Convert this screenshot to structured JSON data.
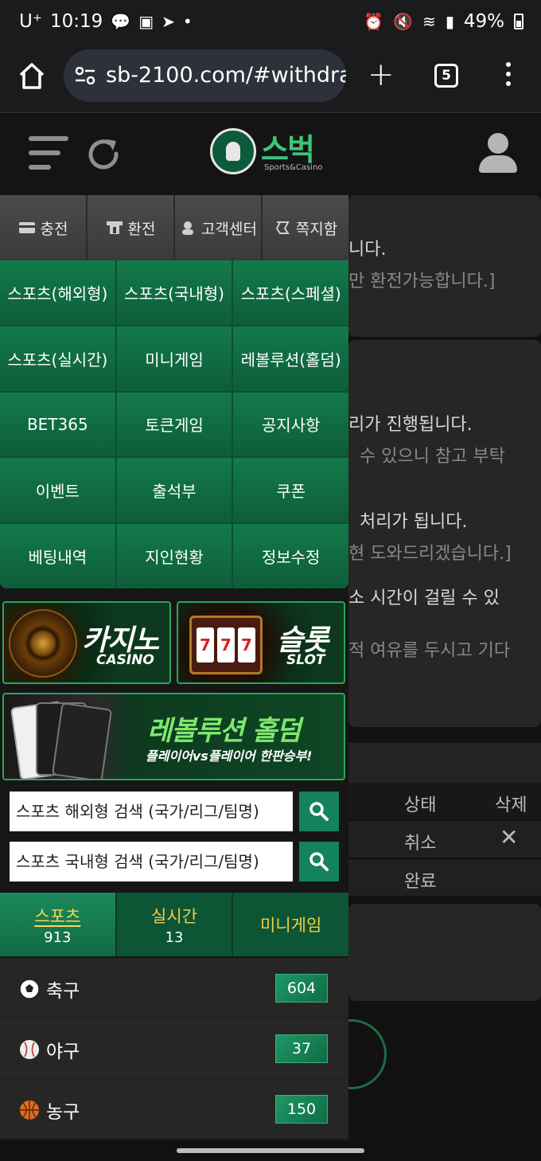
{
  "status_bar": {
    "carrier": "U⁺",
    "time": "10:19",
    "battery": "49%"
  },
  "browser": {
    "url": "sb-2100.com/#withdraw",
    "tab_count": "5"
  },
  "site": {
    "logo_name": "스벅",
    "logo_sub": "Sports&Casino"
  },
  "top_buttons": [
    {
      "label": "충전",
      "icon": "card-icon"
    },
    {
      "label": "환전",
      "icon": "atm-icon"
    },
    {
      "label": "고객센터",
      "icon": "support-agent-icon"
    },
    {
      "label": "쪽지함",
      "icon": "message-icon"
    }
  ],
  "game_menu": [
    "스포츠(해외형)",
    "스포츠(국내형)",
    "스포츠(스페셜)",
    "스포츠(실시간)",
    "미니게임",
    "레볼루션(홀덤)",
    "BET365",
    "토큰게임",
    "공지사항",
    "이벤트",
    "출석부",
    "쿠폰",
    "베팅내역",
    "지인현황",
    "정보수정"
  ],
  "banners": {
    "casino_ko": "카지노",
    "casino_en": "CASINO",
    "slot_ko": "슬롯",
    "slot_en": "SLOT",
    "holdem_title": "레볼루션 홀덤",
    "holdem_sub": "플레이어vs플레이어 한판승부!"
  },
  "search": {
    "overseas": "스포츠 해외형 검색 (국가/리그/팀명)",
    "domestic": "스포츠 국내형 검색 (국가/리그/팀명)"
  },
  "category_tabs": [
    {
      "label": "스포츠",
      "count": "913"
    },
    {
      "label": "실시간",
      "count": "13"
    },
    {
      "label": "미니게임",
      "count": ""
    }
  ],
  "sports": [
    {
      "name": "축구",
      "count": "604",
      "icon": "soccer-ball-icon"
    },
    {
      "name": "야구",
      "count": "37",
      "icon": "baseball-icon"
    },
    {
      "name": "농구",
      "count": "150",
      "icon": "basketball-icon"
    }
  ],
  "background_page": {
    "line1": "니다.",
    "line2": "만 환전가능합니다.]",
    "line3": "리가 진행됩니다.",
    "line4": "수 있으니 참고 부탁",
    "line5": "처리가 됩니다.",
    "line6": "현 도와드리겠습니다.]",
    "line7": "소 시간이 걸릴 수 있",
    "line8": "적 여유를 두시고 기다",
    "col_status": "상태",
    "col_delete": "삭제",
    "row1_status": "취소",
    "row1_delete": "✕",
    "row2_status": "완료"
  }
}
